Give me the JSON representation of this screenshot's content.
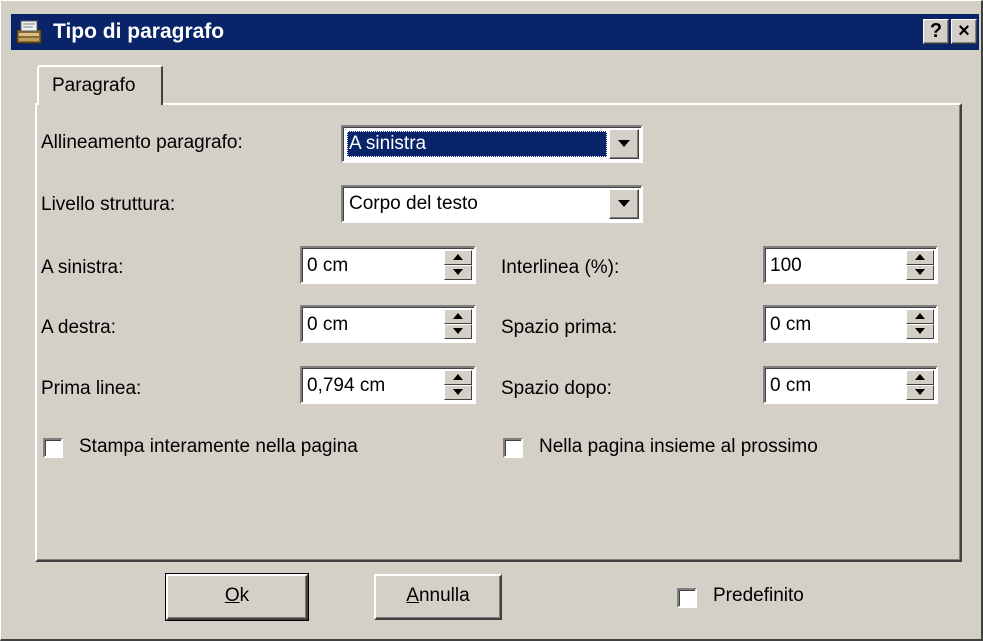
{
  "window": {
    "title": "Tipo di paragrafo",
    "help_label": "?",
    "close_label": "×"
  },
  "tabs": [
    {
      "label": "Paragrafo",
      "active": true
    }
  ],
  "form": {
    "alignment": {
      "label": "Allineamento paragrafo:",
      "value": "A sinistra"
    },
    "outline_level": {
      "label": "Livello struttura:",
      "value": "Corpo del testo"
    },
    "left_indent": {
      "label": "A sinistra:",
      "value": "0 cm"
    },
    "right_indent": {
      "label": "A destra:",
      "value": "0 cm"
    },
    "first_line": {
      "label": "Prima linea:",
      "value": "0,794 cm"
    },
    "line_spacing": {
      "label": "Interlinea (%):",
      "value": "100"
    },
    "space_before": {
      "label": "Spazio prima:",
      "value": "0 cm"
    },
    "space_after": {
      "label": "Spazio dopo:",
      "value": "0 cm"
    },
    "keep_together": {
      "label": "Stampa interamente nella pagina",
      "checked": false
    },
    "keep_with_next": {
      "label": "Nella pagina insieme al prossimo",
      "checked": false
    }
  },
  "footer": {
    "ok_mnemonic": "O",
    "ok_rest": "k",
    "cancel_mnemonic": "A",
    "cancel_rest": "nnulla",
    "default_label": "Predefinito",
    "default_checked": false
  },
  "colors": {
    "face": "#d4d0c8",
    "titlebar": "#0a246a",
    "selection": "#0a246a"
  },
  "icons": [
    "app-typewriter-icon",
    "help-icon",
    "close-icon",
    "dropdown-arrow-icon",
    "spin-up-icon",
    "spin-down-icon"
  ]
}
